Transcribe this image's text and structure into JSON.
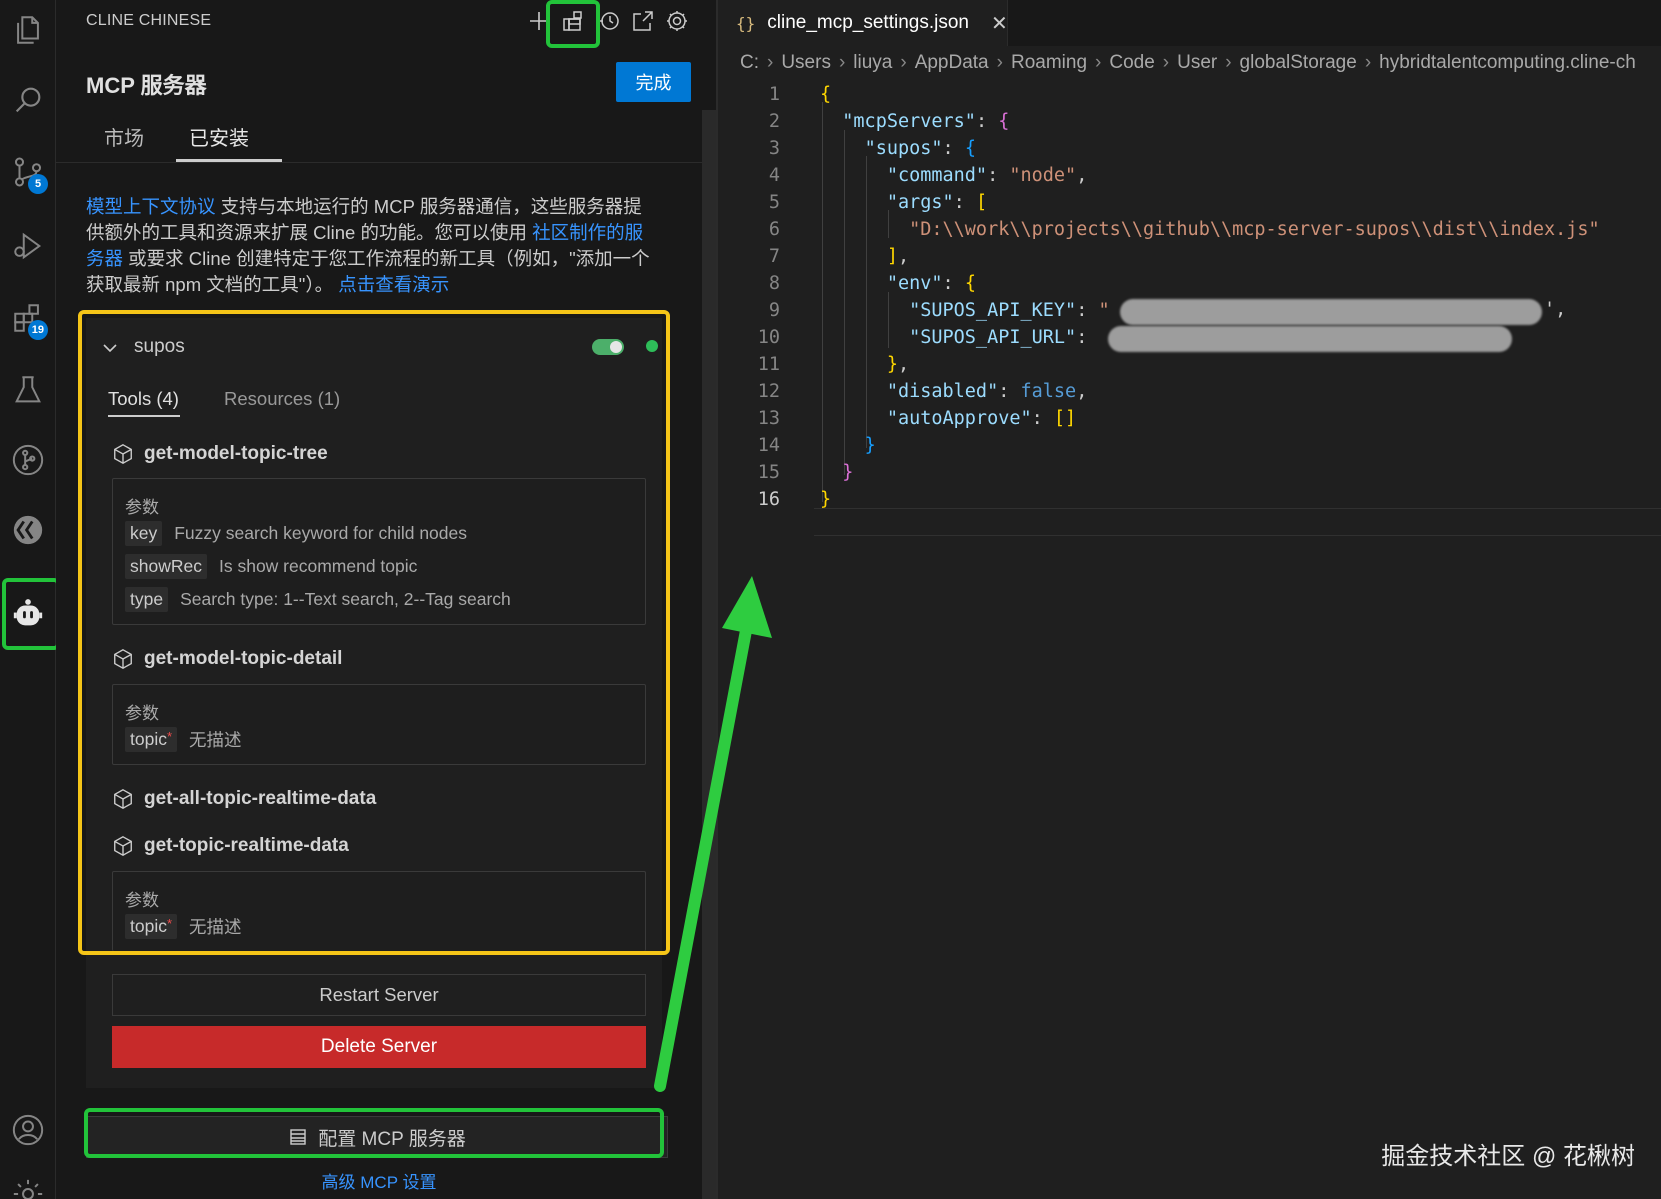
{
  "activity_bar": {
    "items": [
      {
        "name": "explorer",
        "icon": "files-icon"
      },
      {
        "name": "search",
        "icon": "search-icon"
      },
      {
        "name": "source-control",
        "icon": "source-control-icon",
        "badge": "5"
      },
      {
        "name": "run-debug",
        "icon": "run-debug-icon"
      },
      {
        "name": "extensions",
        "icon": "extensions-icon",
        "badge": "19"
      },
      {
        "name": "testing",
        "icon": "beaker-icon"
      },
      {
        "name": "git-graph",
        "icon": "git-graph-icon"
      },
      {
        "name": "remote",
        "icon": "remote-icon"
      },
      {
        "name": "cline",
        "icon": "robot-icon"
      }
    ],
    "bottom": [
      {
        "name": "accounts",
        "icon": "account-icon"
      },
      {
        "name": "manage",
        "icon": "gear-icon"
      }
    ]
  },
  "panel": {
    "header_title": "CLINE CHINESE",
    "header_icons": [
      "plus-icon",
      "mcp-servers-icon",
      "history-icon",
      "popout-icon",
      "settings-icon"
    ],
    "title": "MCP 服务器",
    "done_label": "完成",
    "tabs": [
      {
        "label": "市场",
        "active": false
      },
      {
        "label": "已安装",
        "active": true
      }
    ],
    "intro": {
      "link1": "模型上下文协议",
      "text1": " 支持与本地运行的 MCP 服务器通信，这些服务器提供额外的工具和资源来扩展 Cline 的功能。您可以使用 ",
      "link2": "社区制作的服务器",
      "text2": " 或要求 Cline 创建特定于您工作流程的新工具（例如，\"添加一个获取最新 npm 文档的工具\"）。 ",
      "link3": "点击查看演示"
    },
    "server": {
      "name": "supos",
      "enabled": true,
      "status_color": "#2ebd59",
      "tabs": [
        "Tools (4)",
        "Resources (1)"
      ],
      "params_label": "参数",
      "tools": [
        {
          "name": "get-model-topic-tree",
          "params": [
            {
              "key": "key",
              "required": false,
              "desc": "Fuzzy search keyword for child nodes"
            },
            {
              "key": "showRec",
              "required": false,
              "desc": "Is show recommend topic"
            },
            {
              "key": "type",
              "required": false,
              "desc": "Search type: 1--Text search, 2--Tag search"
            }
          ]
        },
        {
          "name": "get-model-topic-detail",
          "params": [
            {
              "key": "topic",
              "required": true,
              "desc": "无描述"
            }
          ]
        },
        {
          "name": "get-all-topic-realtime-data",
          "params": []
        },
        {
          "name": "get-topic-realtime-data",
          "params": [
            {
              "key": "topic",
              "required": true,
              "desc": "无描述"
            }
          ]
        }
      ],
      "required_mark": "*",
      "restart_label": "Restart Server",
      "delete_label": "Delete Server"
    },
    "configure_label": "配置 MCP 服务器",
    "advanced_label": "高级 MCP 设置"
  },
  "editor": {
    "tab_icon": "{}",
    "tab_title": "cline_mcp_settings.json",
    "breadcrumb": [
      "C:",
      "Users",
      "liuya",
      "AppData",
      "Roaming",
      "Code",
      "User",
      "globalStorage",
      "hybridtalentcomputing.cline-ch"
    ],
    "current_line": 16,
    "code": {
      "line_numbers": [
        "1",
        "2",
        "3",
        "4",
        "5",
        "6",
        "7",
        "8",
        "9",
        "10",
        "11",
        "12",
        "13",
        "14",
        "15",
        "16"
      ],
      "mcpServers_key": "\"mcpServers\"",
      "supos_key": "\"supos\"",
      "command_key": "\"command\"",
      "command_val": "\"node\"",
      "args_key": "\"args\"",
      "args_val": "\"D:\\\\work\\\\projects\\\\github\\\\mcp-server-supos\\\\dist\\\\index.js\"",
      "env_key": "\"env\"",
      "api_key_key": "\"SUPOS_API_KEY\"",
      "api_url_key": "\"SUPOS_API_URL\"",
      "disabled_key": "\"disabled\"",
      "disabled_val": "false",
      "autoApprove_key": "\"autoApprove\"",
      "autoApprove_val": "[]"
    }
  },
  "watermark": "掘金技术社区 @ 花楸树",
  "colors": {
    "accent": "#0078d4",
    "highlight_green": "#22c33a",
    "highlight_yellow": "#f5c518",
    "delete_red": "#c72a2a"
  }
}
